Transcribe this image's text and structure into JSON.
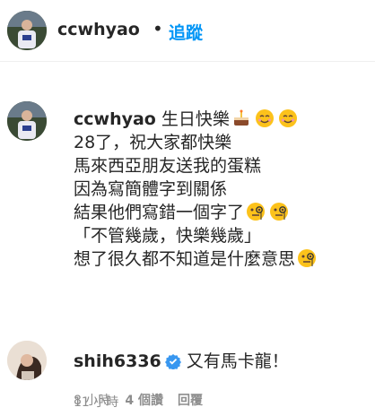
{
  "header": {
    "username": "ccwhyao",
    "separator": "•",
    "follow_label": "追蹤"
  },
  "post": {
    "username": "ccwhyao",
    "caption_lines": [
      "生日快樂",
      "28了，祝大家都快樂",
      "馬來西亞朋友送我的蛋糕",
      "因為寫簡體字到關係",
      "結果他們寫錯一個字了",
      "「不管幾歲，快樂幾歲」",
      "想了很久都不知道是什麼意思"
    ],
    "emojis": {
      "line1": [
        "cake-emoji",
        "smiling-face-emoji",
        "smiling-face-emoji"
      ],
      "line5": [
        "monocle-face-emoji",
        "monocle-face-emoji"
      ],
      "line7": [
        "monocle-face-emoji"
      ]
    },
    "time": "11 小時"
  },
  "comment": {
    "username": "shih6336",
    "verified": true,
    "text": "又有馬卡龍！",
    "time": "8 小時",
    "likes": "4 個讚",
    "reply_label": "回覆"
  },
  "colors": {
    "text": "#262626",
    "muted": "#8e8e8e",
    "link": "#0095f6",
    "divider": "#efefef"
  }
}
